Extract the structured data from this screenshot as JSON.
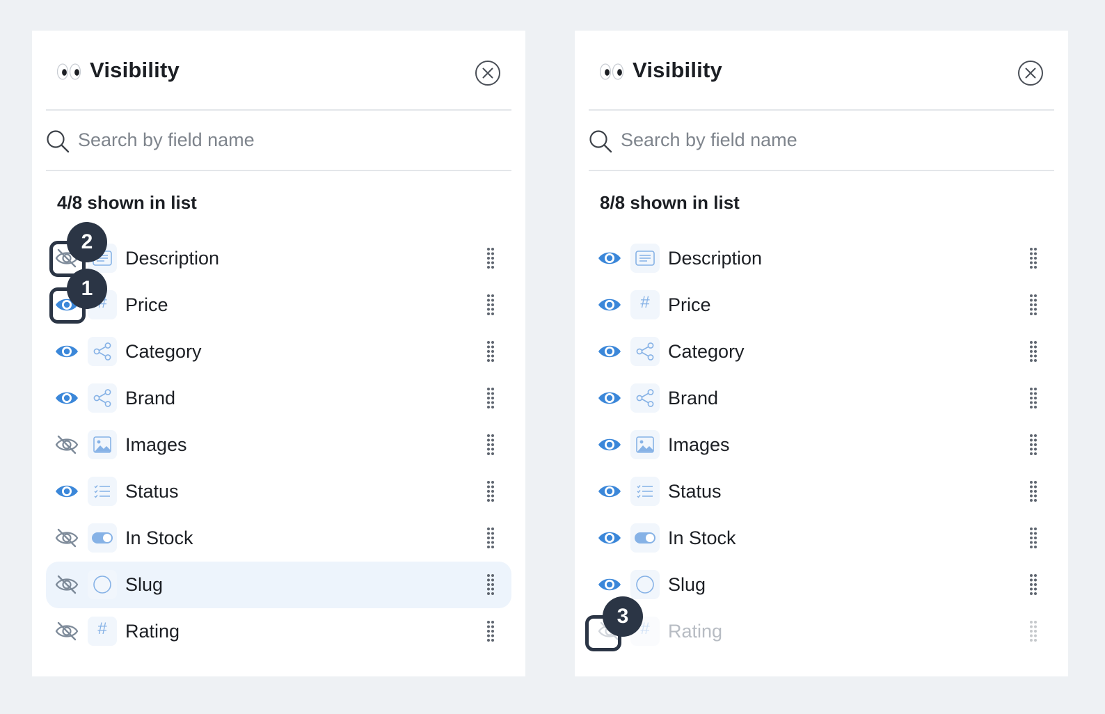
{
  "colors": {
    "accent": "#3b87d9",
    "muted_icon": "#7d8a99",
    "badge": "#2b3545",
    "row_highlight": "#edf4fc",
    "background": "#eef1f4"
  },
  "panels": [
    {
      "title": "Visibility",
      "title_icon": "eyes-emoji-icon",
      "close_icon": "close-circle-icon",
      "search": {
        "placeholder": "Search by field name",
        "value": ""
      },
      "count_label": "4/8 shown in list",
      "fields": [
        {
          "label": "Description",
          "visible": false,
          "type_icon": "text-lines-icon"
        },
        {
          "label": "Price",
          "visible": true,
          "type_icon": "hash-icon"
        },
        {
          "label": "Category",
          "visible": true,
          "type_icon": "relation-icon"
        },
        {
          "label": "Brand",
          "visible": true,
          "type_icon": "relation-icon"
        },
        {
          "label": "Images",
          "visible": false,
          "type_icon": "image-icon"
        },
        {
          "label": "Status",
          "visible": true,
          "type_icon": "list-icon"
        },
        {
          "label": "In Stock",
          "visible": false,
          "type_icon": "toggle-icon"
        },
        {
          "label": "Slug",
          "visible": false,
          "type_icon": "circle-icon",
          "hovered": true
        },
        {
          "label": "Rating",
          "visible": false,
          "type_icon": "hash-icon"
        }
      ],
      "callouts": [
        {
          "number": "2",
          "target": "Description"
        },
        {
          "number": "1",
          "target": "Price"
        }
      ]
    },
    {
      "title": "Visibility",
      "title_icon": "eyes-emoji-icon",
      "close_icon": "close-circle-icon",
      "search": {
        "placeholder": "Search by field name",
        "value": ""
      },
      "count_label": "8/8 shown in list",
      "fields": [
        {
          "label": "Description",
          "visible": true,
          "type_icon": "text-lines-icon"
        },
        {
          "label": "Price",
          "visible": true,
          "type_icon": "hash-icon"
        },
        {
          "label": "Category",
          "visible": true,
          "type_icon": "relation-icon"
        },
        {
          "label": "Brand",
          "visible": true,
          "type_icon": "relation-icon"
        },
        {
          "label": "Images",
          "visible": true,
          "type_icon": "image-icon"
        },
        {
          "label": "Status",
          "visible": true,
          "type_icon": "list-icon"
        },
        {
          "label": "In Stock",
          "visible": true,
          "type_icon": "toggle-icon"
        },
        {
          "label": "Slug",
          "visible": true,
          "type_icon": "circle-icon"
        },
        {
          "label": "Rating",
          "visible": false,
          "type_icon": "hash-icon",
          "disabled": true
        }
      ],
      "callouts": [
        {
          "number": "3",
          "target": "Rating"
        }
      ]
    }
  ]
}
